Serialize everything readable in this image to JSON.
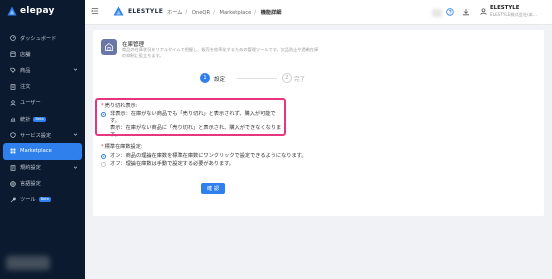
{
  "sidebar": {
    "logo": "elepay",
    "items": [
      {
        "label": "ダッシュボード",
        "icon": "dashboard-icon"
      },
      {
        "label": "店舗",
        "icon": "store-icon"
      },
      {
        "label": "商品",
        "icon": "product-icon",
        "chevron": true
      },
      {
        "label": "注文",
        "icon": "order-icon"
      },
      {
        "label": "ユーザー",
        "icon": "user-icon"
      },
      {
        "label": "統計",
        "icon": "stats-icon",
        "badge": "Beta"
      },
      {
        "label": "サービス設定",
        "icon": "service-icon",
        "chevron": true
      },
      {
        "label": "Marketplace",
        "icon": "marketplace-icon",
        "active": true
      },
      {
        "label": "規約設定",
        "icon": "terms-icon",
        "chevron": true
      },
      {
        "label": "言語設定",
        "icon": "language-icon"
      },
      {
        "label": "ツール",
        "icon": "tool-icon",
        "badge": "Beta"
      }
    ]
  },
  "header": {
    "brand": "ELESTYLE",
    "breadcrumb": [
      "ホーム",
      "OneQR",
      "Marketplace",
      "機能詳細"
    ],
    "user_name": "ELESTYLE",
    "user_sub": "ELESTYLE株式会社(本..."
  },
  "app": {
    "title": "在庫管理",
    "description": "商品の在庫状況をリアルタイムで把握し、販売を効率化するための管理ツールです。欠品防止や過剰在庫の抑制に役立ちます。"
  },
  "steps": [
    {
      "num": "1",
      "label": "設定"
    },
    {
      "num": "2",
      "label": "完了"
    }
  ],
  "sold_out": {
    "label": "売り切れ表示:",
    "options": [
      {
        "line1": "非表示：在庫がない商品でも「売り切れ」と表示されず、購入が可能です。",
        "line2": "表示：在庫がない商品に「売り切れ」と表示され、購入ができなくなります。"
      }
    ]
  },
  "standard_stock": {
    "label": "標準在庫数設定:",
    "options": [
      {
        "text": "オン：商品の理論在庫数を標準在庫数にワンクリックで設定できるようになります。"
      },
      {
        "text": "オフ：理論在庫数は手動で設定する必要があります。"
      }
    ]
  },
  "confirm_label": "確 認",
  "colors": {
    "accent": "#2f80ed",
    "highlight": "#e8357f",
    "sidebar_bg": "#0b1a2e"
  }
}
